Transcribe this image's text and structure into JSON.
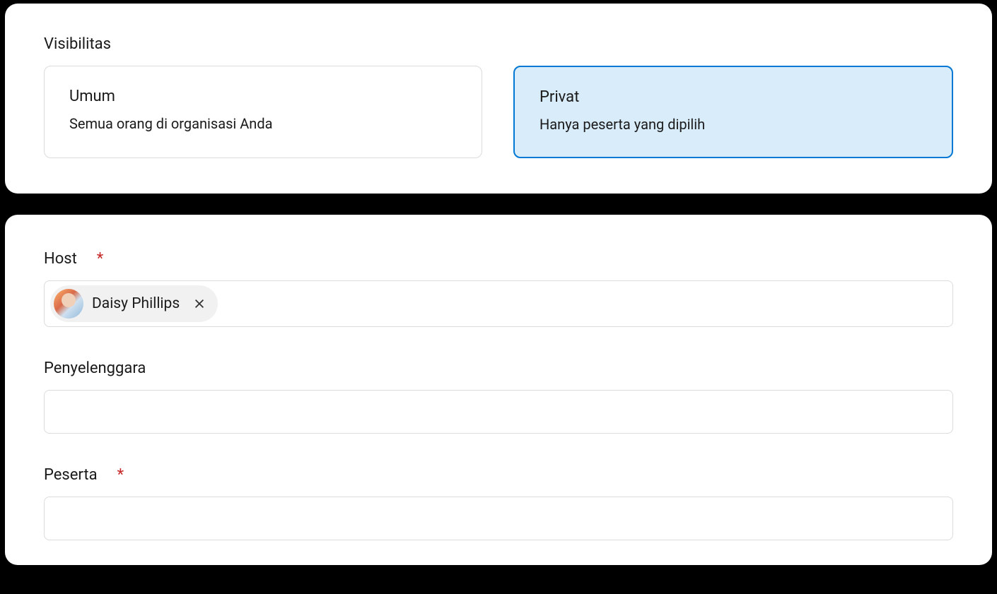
{
  "visibility": {
    "label": "Visibilitas",
    "options": [
      {
        "title": "Umum",
        "desc": "Semua orang di organisasi Anda",
        "selected": false
      },
      {
        "title": "Privat",
        "desc": "Hanya peserta yang dipilih",
        "selected": true
      }
    ]
  },
  "host": {
    "label": "Host",
    "required": "*",
    "chips": [
      {
        "name": "Daisy Phillips"
      }
    ]
  },
  "organizer": {
    "label": "Penyelenggara"
  },
  "participants": {
    "label": "Peserta",
    "required": "*"
  }
}
